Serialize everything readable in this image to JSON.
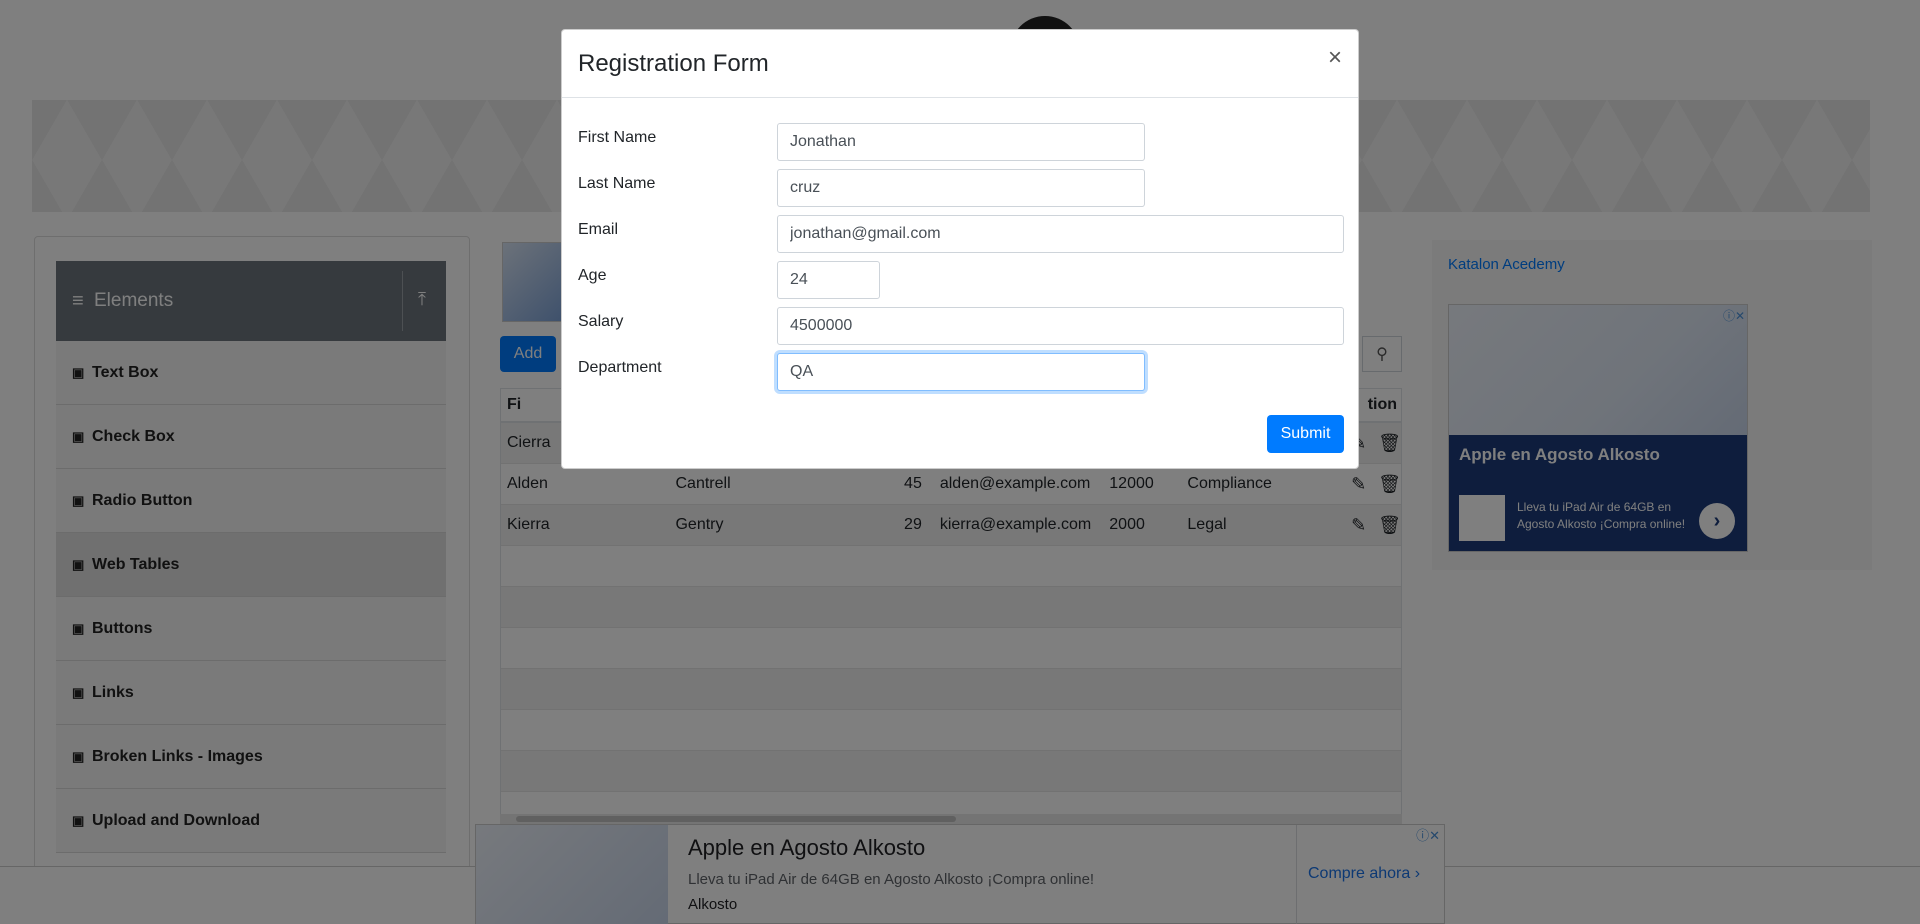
{
  "sidebar": {
    "group_title": "Elements",
    "items": [
      {
        "label": "Text Box"
      },
      {
        "label": "Check Box"
      },
      {
        "label": "Radio Button"
      },
      {
        "label": "Web Tables"
      },
      {
        "label": "Buttons"
      },
      {
        "label": "Links"
      },
      {
        "label": "Broken Links - Images"
      },
      {
        "label": "Upload and Download"
      }
    ]
  },
  "main": {
    "add_label": "Add",
    "table": {
      "headers": [
        "Fi",
        "",
        "",
        "",
        "",
        "",
        "tion"
      ],
      "rows": [
        {
          "first": "Cierra",
          "last": "",
          "age": "",
          "email": "",
          "salary": "",
          "dept": ""
        },
        {
          "first": "Alden",
          "last": "Cantrell",
          "age": "45",
          "email": "alden@example.com",
          "salary": "12000",
          "dept": "Compliance"
        },
        {
          "first": "Kierra",
          "last": "Gentry",
          "age": "29",
          "email": "kierra@example.com",
          "salary": "2000",
          "dept": "Legal"
        }
      ]
    }
  },
  "right_ad": {
    "link_text": "Katalon Acedemy",
    "title": "Apple en Agosto Alkosto",
    "description": "Lleva tu iPad Air de 64GB en Agosto Alkosto ¡Compra online!"
  },
  "bottom_ad": {
    "title": "Apple en Agosto Alkosto",
    "description": "Lleva tu iPad Air de 64GB en Agosto Alkosto ¡Compra online!",
    "brand": "Alkosto",
    "cta": "Compre ahora"
  },
  "modal": {
    "title": "Registration Form",
    "close": "×",
    "fields": {
      "first_name": {
        "label": "First Name",
        "value": "Jonathan"
      },
      "last_name": {
        "label": "Last Name",
        "value": "cruz"
      },
      "email": {
        "label": "Email",
        "value": "jonathan@gmail.com"
      },
      "age": {
        "label": "Age",
        "value": "24"
      },
      "salary": {
        "label": "Salary",
        "value": "4500000"
      },
      "department": {
        "label": "Department",
        "value": "QA"
      }
    },
    "submit_label": "Submit"
  },
  "colors": {
    "primary": "#007bff",
    "group_header": "#6c757d",
    "backdrop": "rgba(0,0,0,0.5)"
  }
}
